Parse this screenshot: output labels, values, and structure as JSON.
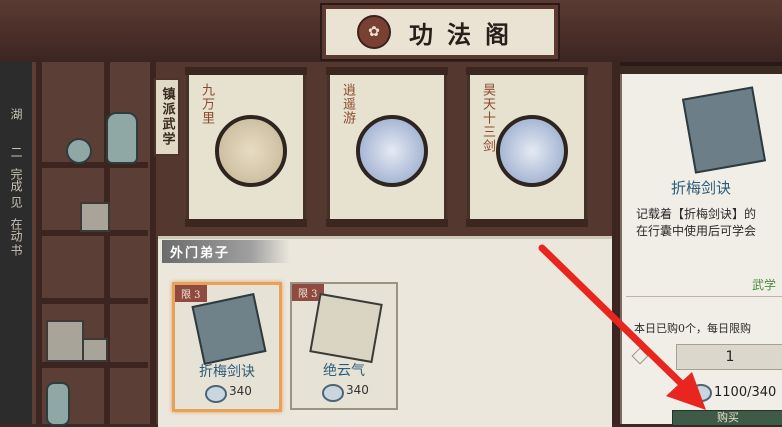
{
  "title": {
    "text": "功法阁",
    "emblem_icon": "lotus-icon"
  },
  "left_sidebar": {
    "texts": [
      "湖",
      "二",
      "完成",
      "见",
      "在动",
      "书"
    ]
  },
  "sect_tag": "镇派武学",
  "featured_scrolls": [
    {
      "name": "九万里",
      "art_icon": "crane-medallion-icon"
    },
    {
      "name": "逍遥游",
      "art_icon": "meditating-figure-medallion-icon"
    },
    {
      "name": "昊天十三剑",
      "art_icon": "sword-medallion-icon"
    }
  ],
  "disciple_section": {
    "header": "外门弟子",
    "items": [
      {
        "limit": "限 3",
        "name": "折梅剑诀",
        "price": "340",
        "art_icon": "manual-book-icon",
        "selected": true
      },
      {
        "limit": "限 3",
        "name": "绝云气",
        "price": "340",
        "art_icon": "scroll-icon",
        "selected": false
      }
    ]
  },
  "detail": {
    "name": "折梅剑诀",
    "desc_line1": "记载着【折梅剑诀】的",
    "desc_line2": "在行囊中使用后可学会",
    "tag": "武学",
    "daily_text": "本日已购0个，每日限购",
    "quantity": "1",
    "cost": "1100/340",
    "buy_label": "购买"
  },
  "colors": {
    "accent": "#e6a25a",
    "wood": "#54372f",
    "paper": "#e7e1d0",
    "arrow": "#e8261f"
  }
}
